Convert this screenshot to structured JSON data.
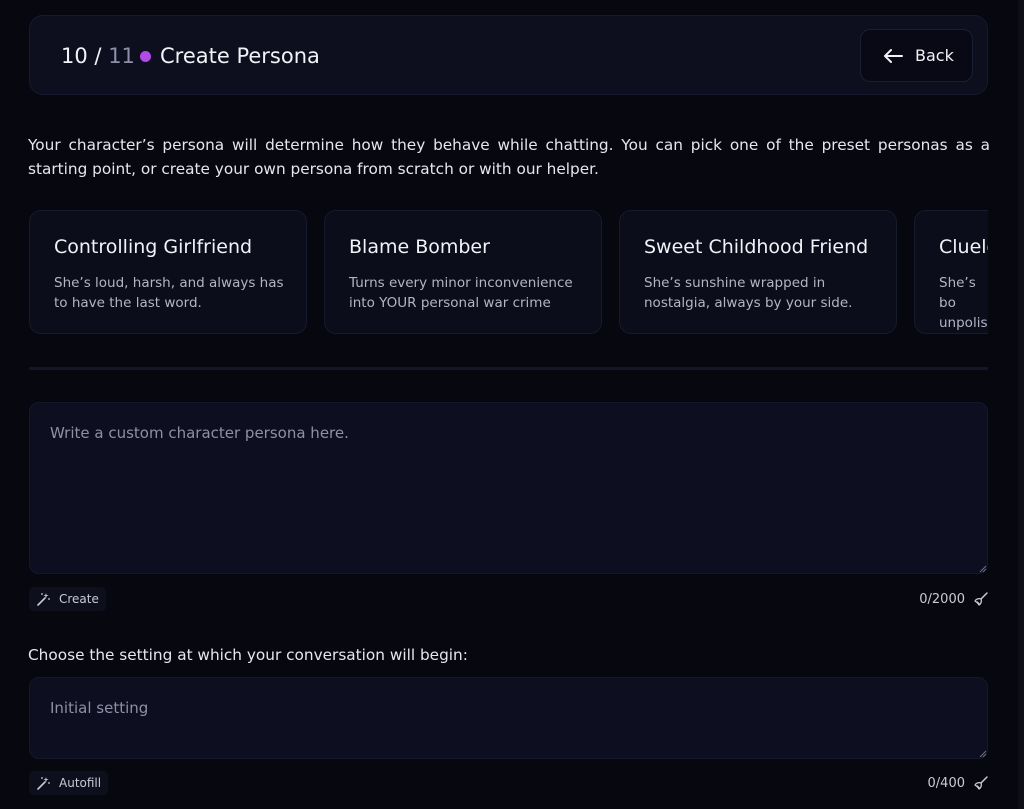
{
  "header": {
    "step_current": "10",
    "step_separator": "/",
    "step_total": "11",
    "title": "Create Persona",
    "back_label": "Back",
    "accent_color": "#b04be6"
  },
  "intro_text": "Your character’s persona will determine how they behave while chatting. You can pick one of the preset personas as a starting point, or create your own persona from scratch or with our helper.",
  "personas": [
    {
      "name": "Controlling Girlfriend",
      "description": "She’s loud, harsh, and always has to have the last word."
    },
    {
      "name": "Blame Bomber",
      "description": "Turns every minor inconvenience into YOUR personal war crime"
    },
    {
      "name": "Sweet Childhood Friend",
      "description": "She’s sunshine wrapped in nostalgia, always by your side."
    },
    {
      "name": "Cluele",
      "description": "She’s bo unpolis"
    }
  ],
  "persona_editor": {
    "placeholder": "Write a custom character persona here.",
    "value": "",
    "create_label": "Create",
    "counter": "0/2000"
  },
  "setting_section": {
    "label": "Choose the setting at which your conversation will begin:",
    "placeholder": "Initial setting",
    "value": "",
    "autofill_label": "Autofill",
    "counter": "0/400"
  }
}
